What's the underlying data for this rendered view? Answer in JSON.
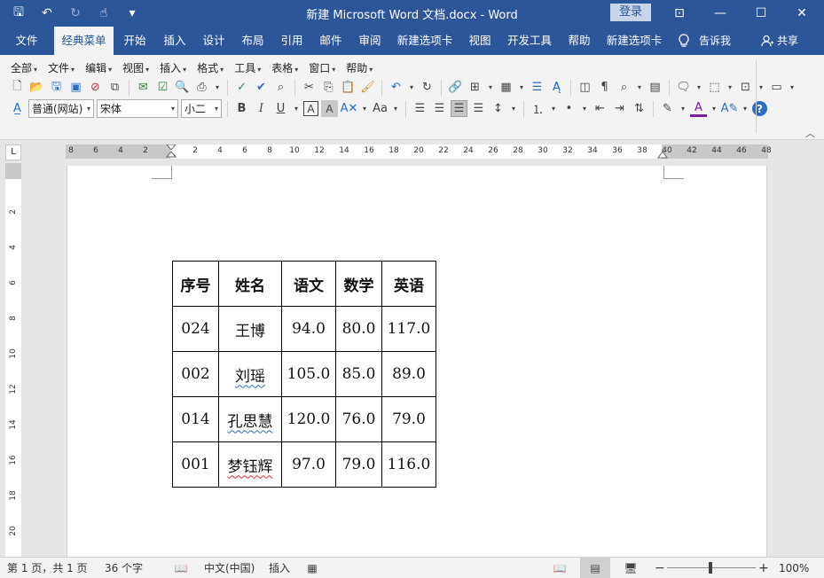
{
  "titlebar": {
    "title": "新建 Microsoft Word 文档.docx  -  Word",
    "login": "登录",
    "qat": [
      {
        "name": "save-icon",
        "glyph": "🖫"
      },
      {
        "name": "undo-icon",
        "glyph": "↶"
      },
      {
        "name": "redo-icon",
        "glyph": "↻"
      },
      {
        "name": "touch-mode-icon",
        "glyph": "☝"
      },
      {
        "name": "customize-qat-icon",
        "glyph": "▾"
      }
    ],
    "controls": {
      "ribbon_options": "⊡",
      "minimize": "—",
      "maximize": "☐",
      "close": "✕"
    }
  },
  "tabs": [
    {
      "label": "文件"
    },
    {
      "label": "经典菜单"
    },
    {
      "label": "开始"
    },
    {
      "label": "插入"
    },
    {
      "label": "设计"
    },
    {
      "label": "布局"
    },
    {
      "label": "引用"
    },
    {
      "label": "邮件"
    },
    {
      "label": "审阅"
    },
    {
      "label": "新建选项卡"
    },
    {
      "label": "视图"
    },
    {
      "label": "开发工具"
    },
    {
      "label": "帮助"
    },
    {
      "label": "新建选项卡"
    }
  ],
  "tellme": {
    "icon": "lightbulb-icon",
    "label": "告诉我"
  },
  "share": {
    "label": "共享"
  },
  "menus": [
    {
      "label": "全部"
    },
    {
      "label": "文件"
    },
    {
      "label": "编辑"
    },
    {
      "label": "视图"
    },
    {
      "label": "插入"
    },
    {
      "label": "格式"
    },
    {
      "label": "工具"
    },
    {
      "label": "表格"
    },
    {
      "label": "窗口"
    },
    {
      "label": "帮助"
    }
  ],
  "format": {
    "style": "普通(网站)",
    "font": "宋体",
    "size": "小二"
  },
  "ruler": {
    "numbers": [
      "8",
      "6",
      "4",
      "2",
      "2",
      "4",
      "6",
      "8",
      "10",
      "12",
      "14",
      "16",
      "18",
      "20",
      "22",
      "24",
      "26",
      "28",
      "30",
      "32",
      "34",
      "36",
      "38",
      "40",
      "42",
      "44",
      "46",
      "48"
    ]
  },
  "vruler": {
    "numbers": [
      "2",
      "4",
      "6",
      "8",
      "10",
      "12",
      "14",
      "16",
      "18",
      "20"
    ]
  },
  "table": {
    "headers": [
      "序号",
      "姓名",
      "语文",
      "数学",
      "英语"
    ],
    "rows": [
      [
        "024",
        "王博",
        "94.0",
        "80.0",
        "117.0"
      ],
      [
        "002",
        "刘瑶",
        "105.0",
        "85.0",
        "89.0"
      ],
      [
        "014",
        "孔思慧",
        "120.0",
        "76.0",
        "79.0"
      ],
      [
        "001",
        "梦钰辉",
        "97.0",
        "79.0",
        "116.0"
      ]
    ]
  },
  "status": {
    "page": "第 1 页，共 1 页",
    "words": "36 个字",
    "language": "中文(中国)",
    "mode": "插入",
    "zoom": "100%"
  }
}
